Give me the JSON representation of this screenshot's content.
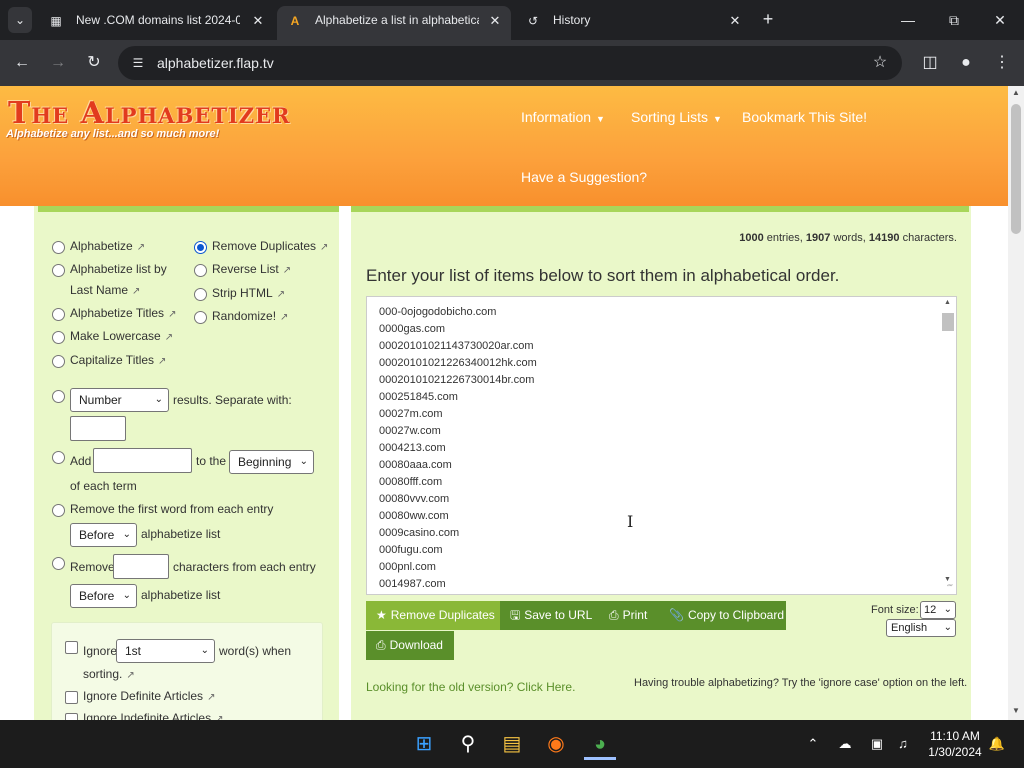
{
  "browser": {
    "tab_list_icon": "chevron-down",
    "tabs": [
      {
        "title": "New .COM domains list 2024-0",
        "icon": "grid-favicon",
        "active": false
      },
      {
        "title": "Alphabetize a list in alphabetica",
        "icon": "alphabetizer-favicon",
        "active": true
      },
      {
        "title": "History",
        "icon": "history-icon",
        "active": false
      }
    ],
    "new_tab_glyph": "+",
    "url": "alphabetizer.flap.tv"
  },
  "site": {
    "logo_title": "The Alphabetizer",
    "logo_tagline": "Alphabetize any list...and so much more!",
    "nav": {
      "information": "Information",
      "sorting_lists": "Sorting Lists",
      "bookmark": "Bookmark This Site!",
      "suggestion": "Have a Suggestion?"
    }
  },
  "options": {
    "alphabetize": "Alphabetize",
    "alphabetize_last_name_1": "Alphabetize list by",
    "alphabetize_last_name_2": "Last Name",
    "alphabetize_titles": "Alphabetize Titles",
    "make_lowercase": "Make Lowercase",
    "capitalize_titles": "Capitalize Titles",
    "remove_duplicates": "Remove Duplicates",
    "reverse_list": "Reverse List",
    "strip_html": "Strip HTML",
    "randomize": "Randomize!",
    "number_select": "Number",
    "results_separate": "results. Separate with:",
    "add_label": "Add",
    "to_the": "to the",
    "position_select": "Beginning",
    "of_each_term": "of each term",
    "remove_first_word": "Remove the first word from each entry",
    "before_select_1": "Before",
    "alphabetize_list_1": "alphabetize list",
    "remove_label": "Remove",
    "characters_from_each": "characters from each entry",
    "before_select_2": "Before",
    "alphabetize_list_2": "alphabetize list",
    "ignore_label": "Ignore",
    "ignore_select": "1st",
    "words_when": "word(s) when",
    "sorting": "sorting.",
    "ignore_definite": "Ignore Definite Articles",
    "ignore_indefinite": "Ignore Indefinite Articles"
  },
  "main": {
    "stats": {
      "entries": "1000",
      "entries_label": "entries,",
      "words": "1907",
      "words_label": "words,",
      "characters": "14190",
      "characters_label": "characters."
    },
    "heading": "Enter your list of items below to sort them in alphabetical order.",
    "list_items": [
      "000-0ojogodobicho.com",
      "0000gas.com",
      "000201010211437300 20ar.com",
      "00020101021226340012hk.com",
      "0002010102122673 0014br.com",
      "000251845.com",
      "00027m.com",
      "00027w.com",
      "0004213.com",
      "00080aaa.com",
      "00080fff.com",
      "00080vvv.com",
      "00080ww.com",
      "0009casino.com",
      "000fugu.com",
      "000pnl.com",
      "0014987.com"
    ],
    "buttons": {
      "remove_duplicates": "Remove Duplicates",
      "save_to_url": "Save to URL",
      "print": "Print",
      "copy_clipboard": "Copy to Clipboard",
      "download": "Download"
    },
    "font_size_label": "Font size:",
    "font_size_value": "12",
    "language_value": "English",
    "old_version_link": "Looking for the old version? Click Here.",
    "help_text": "Having trouble alphabetizing? Try the 'ignore case' option on the left."
  },
  "taskbar": {
    "time": "11:10 AM",
    "date": "1/30/2024"
  }
}
